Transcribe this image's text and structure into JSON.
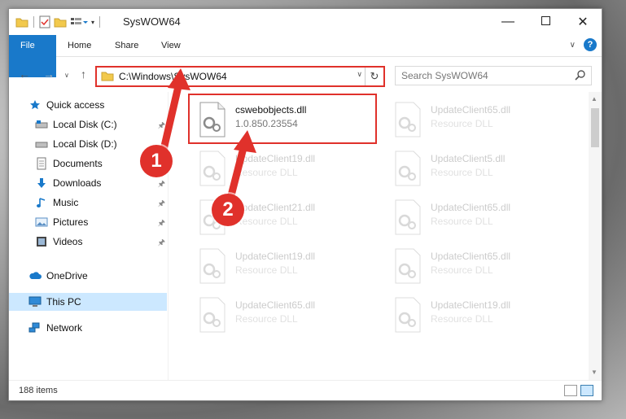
{
  "window": {
    "title": "SysWOW64"
  },
  "ribbon": {
    "tabs": [
      "File",
      "Home",
      "Share",
      "View"
    ]
  },
  "address": {
    "path": "C:\\Windows\\SysWOW64"
  },
  "search": {
    "placeholder": "Search SysWOW64"
  },
  "nav": {
    "items": [
      {
        "label": "Quick access",
        "icon": "star-icon",
        "pinned": false
      },
      {
        "label": "Local Disk (C:)",
        "icon": "drive-icon",
        "pinned": true
      },
      {
        "label": "Local Disk (D:)",
        "icon": "drive-icon",
        "pinned": false
      },
      {
        "label": "Documents",
        "icon": "documents-icon",
        "pinned": true
      },
      {
        "label": "Downloads",
        "icon": "download-icon",
        "pinned": true
      },
      {
        "label": "Music",
        "icon": "music-icon",
        "pinned": true
      },
      {
        "label": "Pictures",
        "icon": "pictures-icon",
        "pinned": true
      },
      {
        "label": "Videos",
        "icon": "videos-icon",
        "pinned": true
      },
      {
        "label": "OneDrive",
        "icon": "cloud-icon",
        "pinned": false
      },
      {
        "label": "This PC",
        "icon": "computer-icon",
        "pinned": false,
        "selected": true
      },
      {
        "label": "Network",
        "icon": "network-icon",
        "pinned": false
      }
    ]
  },
  "files": {
    "highlighted": {
      "name": "cswebobjects.dll",
      "desc": "1.0.850.23554"
    },
    "others": [
      {
        "name": "UpdateClient65.dll",
        "desc": "Resource DLL"
      },
      {
        "name": "UpdateClient19.dll",
        "desc": "Resource DLL"
      },
      {
        "name": "UpdateClient5.dll",
        "desc": "Resource DLL"
      },
      {
        "name": "UpdateClient21.dll",
        "desc": "Resource DLL"
      },
      {
        "name": "UpdateClient65.dll",
        "desc": "Resource DLL"
      },
      {
        "name": "UpdateClient19.dll",
        "desc": "Resource DLL"
      },
      {
        "name": "UpdateClient65.dll",
        "desc": "Resource DLL"
      },
      {
        "name": "UpdateClient65.dll",
        "desc": "Resource DLL"
      },
      {
        "name": "UpdateClient19.dll",
        "desc": "Resource DLL"
      }
    ]
  },
  "status": {
    "count": "188 items"
  },
  "callouts": [
    "1",
    "2"
  ],
  "colors": {
    "accent": "#1979ca",
    "highlight": "#e0312b",
    "selection": "#cce8ff"
  }
}
